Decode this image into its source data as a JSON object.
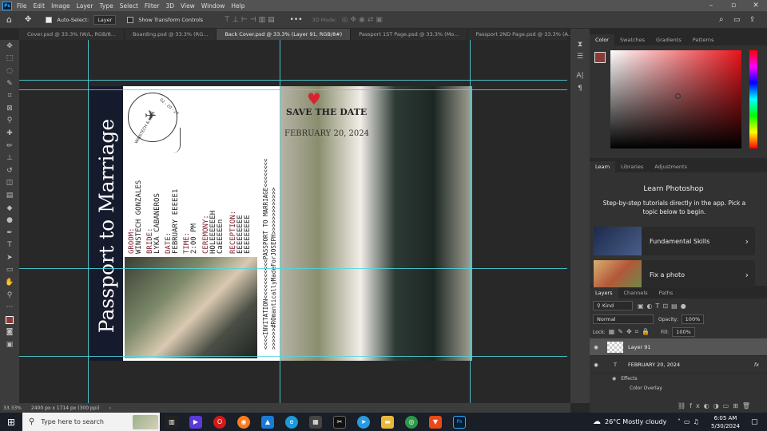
{
  "app": {
    "logo": "Ps"
  },
  "menu": [
    "File",
    "Edit",
    "Image",
    "Layer",
    "Type",
    "Select",
    "Filter",
    "3D",
    "View",
    "Window",
    "Help"
  ],
  "options": {
    "auto_select": "Auto-Select:",
    "auto_select_value": "Layer",
    "transform": "Show Transform Controls",
    "mode3d": "3D Mode:"
  },
  "tabs": [
    "Cover.psd @ 33.3% (W/L, RGB/8...",
    "Boarding.psd @ 33.3% (RG...",
    "Back Cover.psd @ 33.3% (Layer 91, RGB/8#)",
    "Passport 1ST Page.psd @ 33.3% (Mo...",
    "Passport 2ND Page.psd @ 33.3% (A..."
  ],
  "document": {
    "side_title": "Passport to Marriage",
    "groom_label": "GROOM:",
    "groom": "WINSTECH GONZALES",
    "bride_label": "BRIDE:",
    "bride": "LYKA CABANEROS",
    "date_label": "DATE:",
    "date": "FEBRUARY EEEEE1",
    "time_label": "TIME:",
    "time": "2:00 PM",
    "ceremony_label": "CEREMONY:",
    "ceremony1": "HOLEEEEEEH",
    "ceremony2": "CaEEEEEn",
    "reception_label": "RECEPTION:",
    "reception1": "EEEEEEEEE",
    "reception2": "EEEEEEEEE",
    "mrz1": "<<<<INVITATION<<<<<<<<<<<PASSPORT TO MARRIAGE<<<<<<<<",
    "mrz2": ">>>>>>#ROmanticallyMadeForJOSEPH>>>>>>>>>>>>>",
    "stamp_text": "WINSTECH & LYKA",
    "stamp_date": "02 - 20 - 24",
    "save_the_date": "SAVE THE DATE",
    "event_date": "FEBRUARY 20, 2024"
  },
  "status": {
    "zoom": "33.33%",
    "info": "2400 px x 1714 px (300 ppi)"
  },
  "color_panel": {
    "tabs": [
      "Color",
      "Swatches",
      "Gradients",
      "Patterns"
    ]
  },
  "learn_panel": {
    "tabs": [
      "Learn",
      "Libraries",
      "Adjustments"
    ],
    "title": "Learn Photoshop",
    "desc": "Step-by-step tutorials directly in the app. Pick a topic below to begin.",
    "cards": [
      "Fundamental Skills",
      "Fix a photo"
    ]
  },
  "layers_panel": {
    "tabs": [
      "Layers",
      "Channels",
      "Paths"
    ],
    "kind": "Kind",
    "blend": "Normal",
    "opacity_label": "Opacity:",
    "opacity": "100%",
    "lock_label": "Lock:",
    "fill_label": "Fill:",
    "fill": "100%",
    "layers": [
      "Layer 91",
      "FEBRUARY 20, 2024"
    ],
    "effects": "Effects",
    "color_overlay": "Color Overlay"
  },
  "taskbar": {
    "search": "Type here to search",
    "weather": "26°C  Mostly cloudy",
    "time": "6:05 AM",
    "date": "5/30/2024"
  },
  "colors": {
    "accent": "#31a8ff",
    "foreground": "#8b3a3a",
    "guide": "#4fd6e0"
  }
}
